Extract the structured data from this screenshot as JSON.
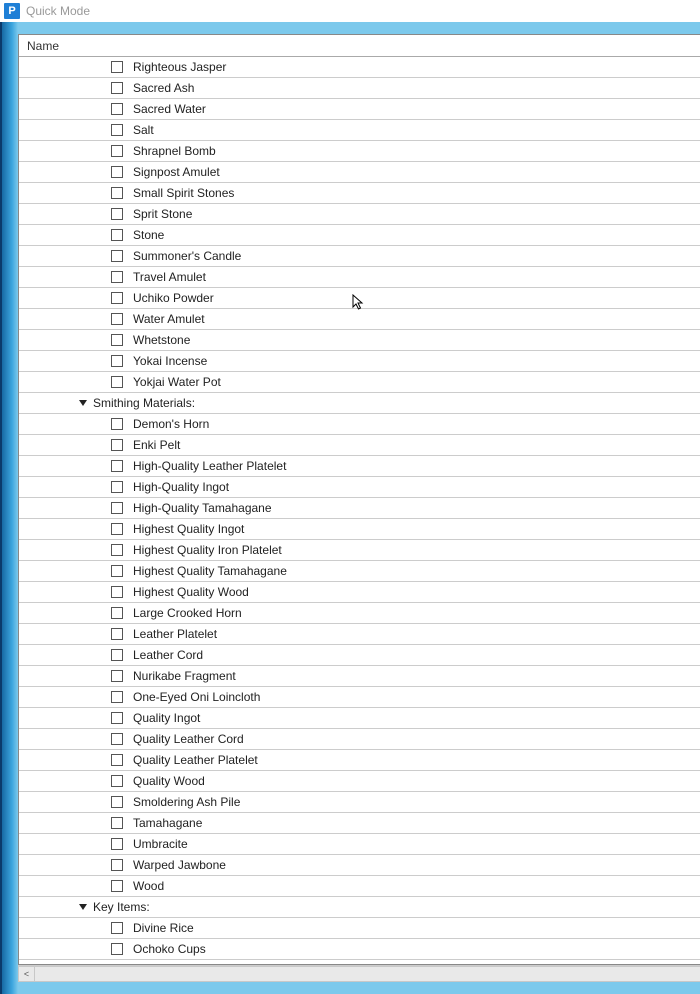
{
  "window": {
    "title": "Quick Mode",
    "icon_letter": "P"
  },
  "grid": {
    "header": "Name",
    "rows": [
      {
        "type": "item",
        "label": "Righteous Jasper"
      },
      {
        "type": "item",
        "label": "Sacred Ash"
      },
      {
        "type": "item",
        "label": "Sacred Water"
      },
      {
        "type": "item",
        "label": "Salt"
      },
      {
        "type": "item",
        "label": "Shrapnel Bomb"
      },
      {
        "type": "item",
        "label": "Signpost Amulet"
      },
      {
        "type": "item",
        "label": "Small Spirit Stones"
      },
      {
        "type": "item",
        "label": "Sprit Stone"
      },
      {
        "type": "item",
        "label": "Stone"
      },
      {
        "type": "item",
        "label": "Summoner's Candle"
      },
      {
        "type": "item",
        "label": "Travel Amulet"
      },
      {
        "type": "item",
        "label": "Uchiko Powder"
      },
      {
        "type": "item",
        "label": "Water Amulet"
      },
      {
        "type": "item",
        "label": "Whetstone"
      },
      {
        "type": "item",
        "label": "Yokai Incense"
      },
      {
        "type": "item",
        "label": "Yokjai Water Pot"
      },
      {
        "type": "group",
        "label": "Smithing Materials:"
      },
      {
        "type": "item",
        "label": "Demon's Horn"
      },
      {
        "type": "item",
        "label": "Enki Pelt"
      },
      {
        "type": "item",
        "label": "High-Quality Leather Platelet"
      },
      {
        "type": "item",
        "label": "High-Quality Ingot"
      },
      {
        "type": "item",
        "label": "High-Quality Tamahagane"
      },
      {
        "type": "item",
        "label": "Highest Quality Ingot"
      },
      {
        "type": "item",
        "label": "Highest Quality Iron Platelet"
      },
      {
        "type": "item",
        "label": "Highest Quality Tamahagane"
      },
      {
        "type": "item",
        "label": "Highest Quality Wood"
      },
      {
        "type": "item",
        "label": "Large Crooked Horn"
      },
      {
        "type": "item",
        "label": "Leather Platelet"
      },
      {
        "type": "item",
        "label": "Leather Cord"
      },
      {
        "type": "item",
        "label": "Nurikabe Fragment"
      },
      {
        "type": "item",
        "label": "One-Eyed Oni Loincloth"
      },
      {
        "type": "item",
        "label": "Quality Ingot"
      },
      {
        "type": "item",
        "label": "Quality Leather Cord"
      },
      {
        "type": "item",
        "label": "Quality Leather Platelet"
      },
      {
        "type": "item",
        "label": "Quality Wood"
      },
      {
        "type": "item",
        "label": "Smoldering Ash Pile"
      },
      {
        "type": "item",
        "label": "Tamahagane"
      },
      {
        "type": "item",
        "label": "Umbracite"
      },
      {
        "type": "item",
        "label": "Warped Jawbone"
      },
      {
        "type": "item",
        "label": "Wood"
      },
      {
        "type": "group",
        "label": "Key Items:"
      },
      {
        "type": "item",
        "label": "Divine Rice"
      },
      {
        "type": "item",
        "label": "Ochoko Cups"
      }
    ]
  },
  "scrollbar": {
    "left_arrow": "<"
  }
}
